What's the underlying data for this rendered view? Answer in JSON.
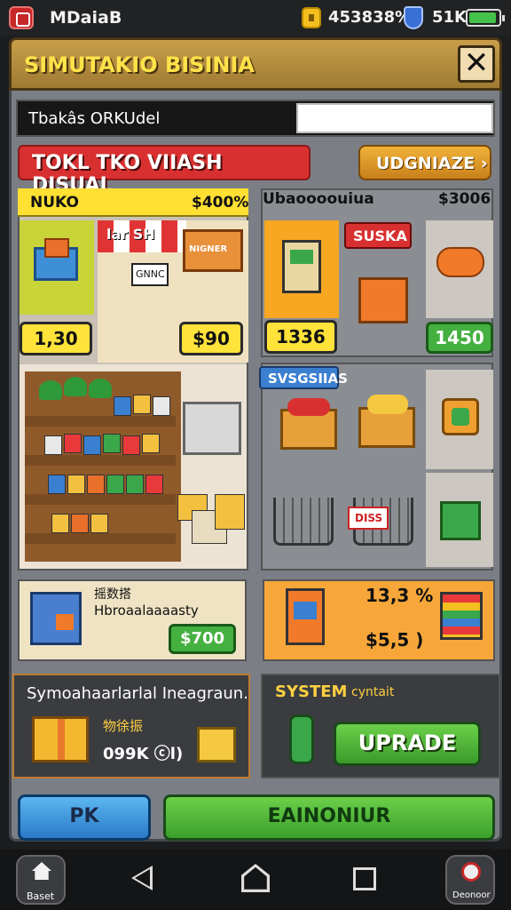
{
  "status_bar": {
    "app_title": "MDaiaB",
    "coins": "453838%",
    "gems": "51K",
    "battery_level": 0.95
  },
  "header": {
    "title": "SIMUTAKIO BISINIA",
    "close_label": "✕"
  },
  "name_bar": {
    "label": "Tbakâs ORKUdel",
    "input_value": ""
  },
  "banner": {
    "label": "TOKL TKO VIIASH DISUAL",
    "upgrade_label": "UDGNIAZE ›"
  },
  "left_card": {
    "header_left": "NUKO",
    "header_right": "$400%",
    "shop_label": "lar SH",
    "sign_label": "NIGNER",
    "small_sign": "GNNC",
    "price_left": "1,30",
    "price_right": "$90"
  },
  "right_card": {
    "header_left": "Ubaoooouiua",
    "header_right": "$3006",
    "sale_badge": "SUSKA",
    "price_left": "1336",
    "price_right": "1450"
  },
  "mid_right": {
    "badge": "SVSGSIIAS",
    "cart_tag": "DISS"
  },
  "bottom_left_item": {
    "title": "摇数搭",
    "subtitle": "Hbroaalaaaasty",
    "price": "$700"
  },
  "bottom_right_item": {
    "percent": "13,3 %",
    "price": "$5,5 )"
  },
  "system_left": {
    "title": "Symoahaarlarlal Ineagraun.",
    "small": "物徐振",
    "amount": "099K ⓒl)"
  },
  "system_right": {
    "title": "SYSTEM",
    "subtitle": "cyntait",
    "button": "UPRADE"
  },
  "actions": {
    "left_button": "PK",
    "main_button": "EAINONIUR"
  },
  "navbar": {
    "left_label": "Baset",
    "right_label": "Deonoor"
  },
  "colors": {
    "accent_gold": "#ffe24a",
    "accent_red": "#d83030",
    "accent_green": "#44b040",
    "accent_blue": "#3a7fd0"
  }
}
